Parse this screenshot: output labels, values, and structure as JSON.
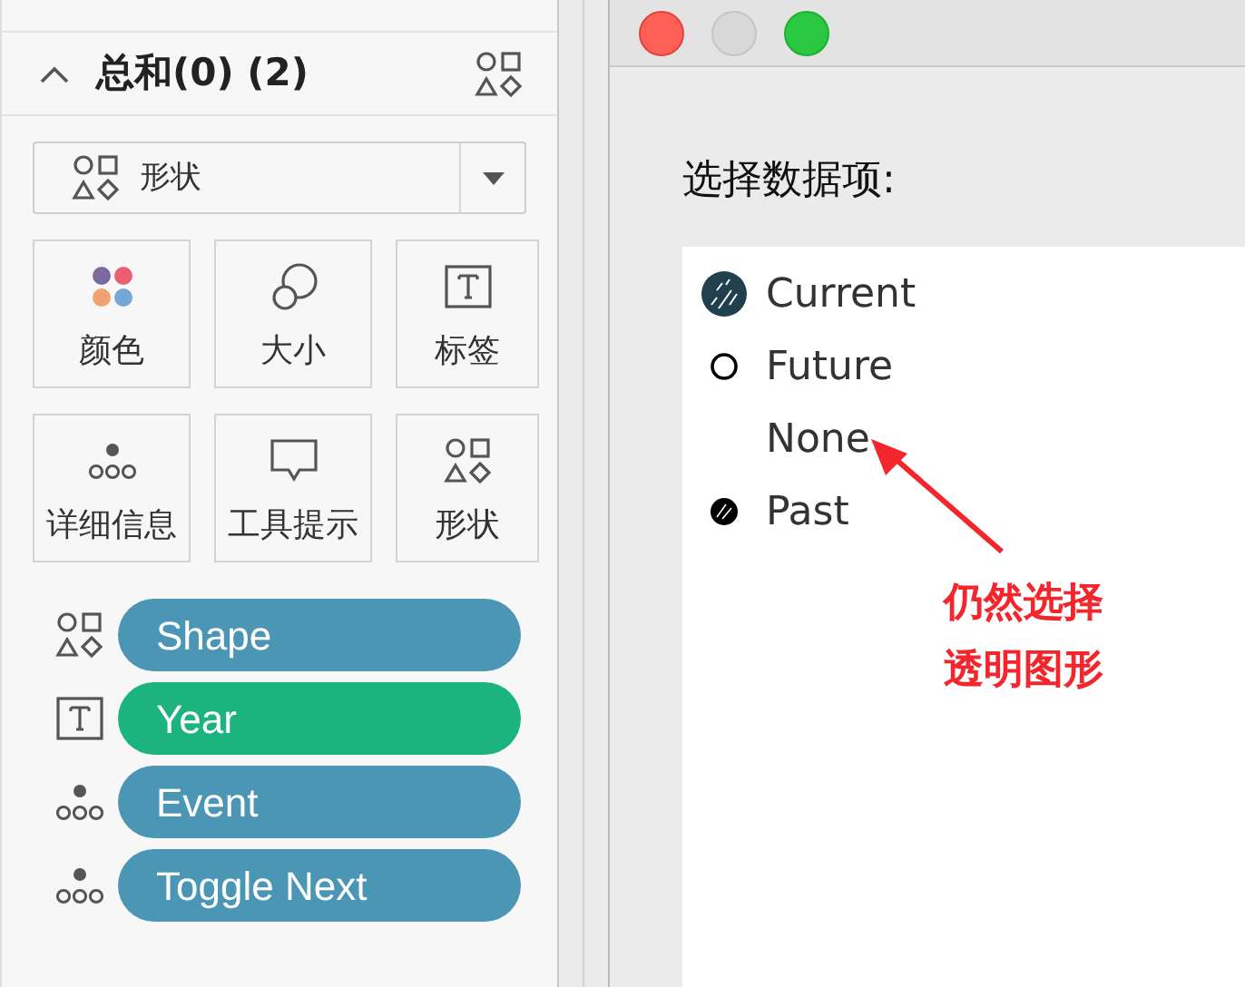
{
  "marks_card": {
    "title": "总和(0) (2)",
    "expanded": true,
    "mark_type": "形状",
    "buttons": [
      {
        "label": "颜色",
        "kind": "color"
      },
      {
        "label": "大小",
        "kind": "size"
      },
      {
        "label": "标签",
        "kind": "label"
      },
      {
        "label": "详细信息",
        "kind": "detail"
      },
      {
        "label": "工具提示",
        "kind": "tooltip"
      },
      {
        "label": "形状",
        "kind": "shape"
      }
    ],
    "fields": [
      {
        "label": "Shape",
        "kind": "shape",
        "color": "#4a96b4"
      },
      {
        "label": "Year",
        "kind": "label",
        "color": "#1db37e"
      },
      {
        "label": "Event",
        "kind": "detail",
        "color": "#4a96b4"
      },
      {
        "label": "Toggle Next",
        "kind": "detail",
        "color": "#4a96b4"
      }
    ]
  },
  "dialog": {
    "prompt": "选择数据项:",
    "items": [
      {
        "label": "Current",
        "kind": "hatched-teal"
      },
      {
        "label": "Future",
        "kind": "open-circle"
      },
      {
        "label": "None",
        "kind": "none"
      },
      {
        "label": "Past",
        "kind": "hatched-black"
      }
    ]
  },
  "annotation": {
    "lines": [
      "仍然选择",
      "透明图形"
    ]
  }
}
